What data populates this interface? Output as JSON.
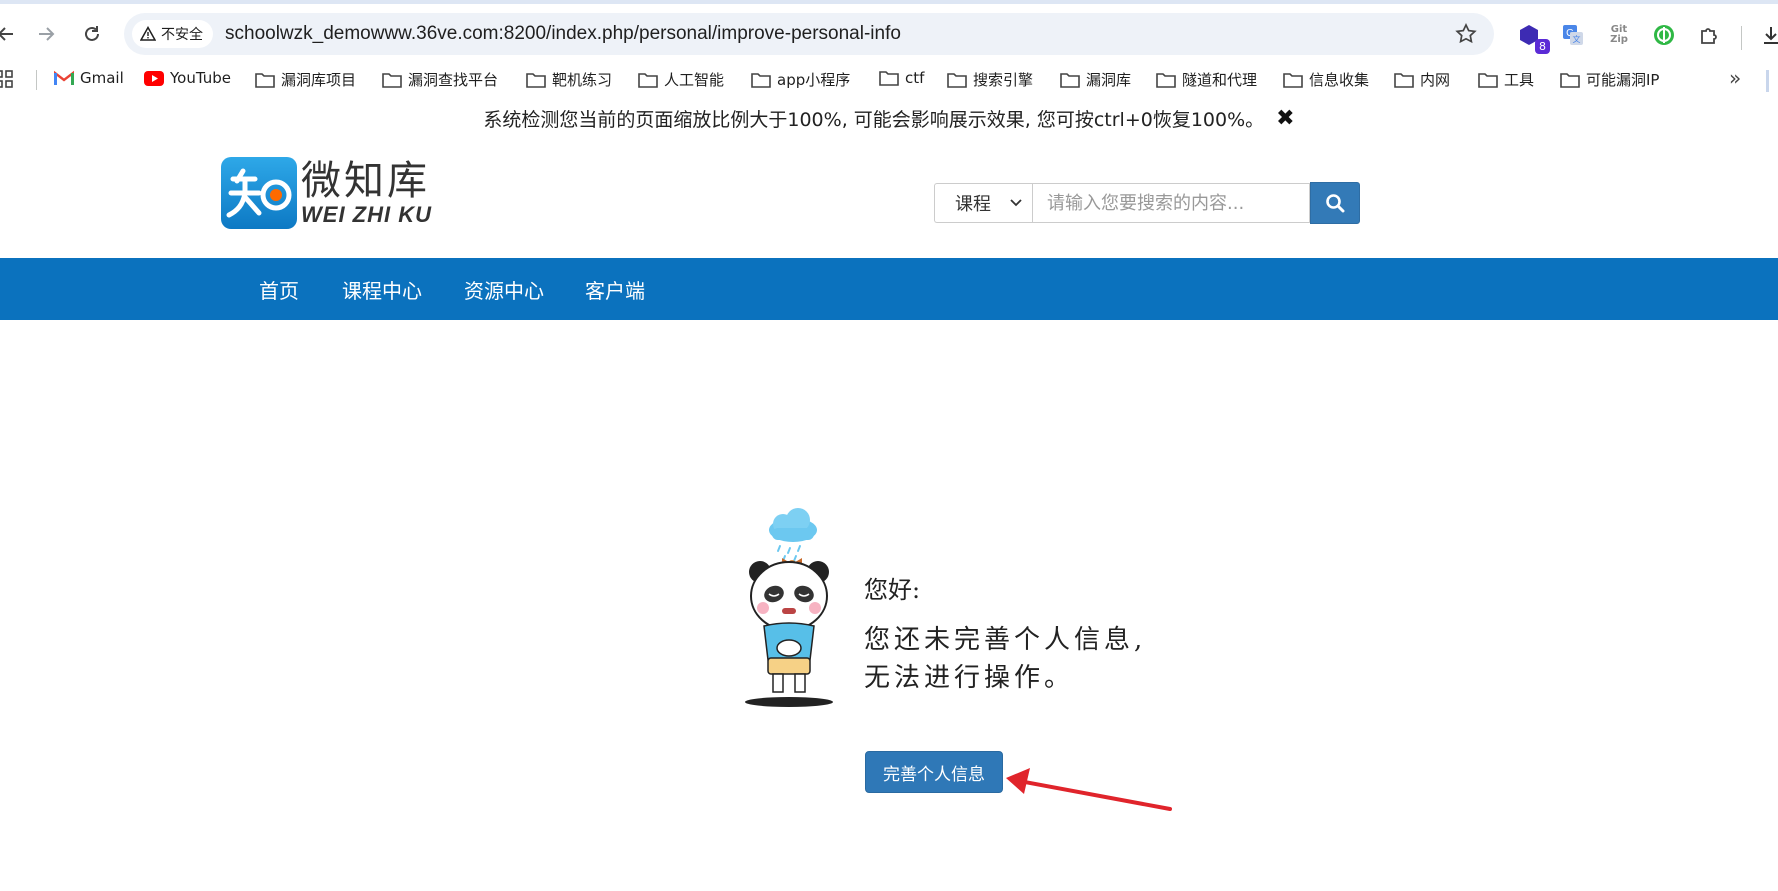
{
  "browser": {
    "security_label": "不安全",
    "url": "schoolwzk_demowww.36ve.com:8200/index.php/personal/improve-personal-info",
    "extension_badge": "8",
    "gitzip_line1": "Git",
    "gitzip_line2": "Zip"
  },
  "bookmarks": [
    {
      "label": "Gmail",
      "icon": "gmail-icon"
    },
    {
      "label": "YouTube",
      "icon": "youtube-icon"
    },
    {
      "label": "漏洞库项目",
      "icon": "folder-icon"
    },
    {
      "label": "漏洞查找平台",
      "icon": "folder-icon"
    },
    {
      "label": "靶机练习",
      "icon": "folder-icon"
    },
    {
      "label": "人工智能",
      "icon": "folder-icon"
    },
    {
      "label": "app小程序",
      "icon": "folder-icon"
    },
    {
      "label": "ctf",
      "icon": "folder-icon"
    },
    {
      "label": "搜索引擎",
      "icon": "folder-icon"
    },
    {
      "label": "漏洞库",
      "icon": "folder-icon"
    },
    {
      "label": "隧道和代理",
      "icon": "folder-icon"
    },
    {
      "label": "信息收集",
      "icon": "folder-icon"
    },
    {
      "label": "内网",
      "icon": "folder-icon"
    },
    {
      "label": "工具",
      "icon": "folder-icon"
    },
    {
      "label": "可能漏洞IP",
      "icon": "folder-icon"
    }
  ],
  "notice": {
    "text": "系统检测您当前的页面缩放比例大于100%, 可能会影响展示效果, 您可按ctrl+0恢复100%。",
    "close": "✖"
  },
  "logo": {
    "mark": "知",
    "cn": "微知库",
    "en": "WEI ZHI KU"
  },
  "search": {
    "category": "课程",
    "placeholder": "请输入您要搜索的内容..."
  },
  "nav": {
    "items": [
      "首页",
      "课程中心",
      "资源中心",
      "客户端"
    ]
  },
  "message": {
    "greeting": "您好:",
    "line1": "您还未完善个人信息,",
    "line2": "无法进行操作。"
  },
  "cta": {
    "label": "完善个人信息"
  },
  "colors": {
    "nav_bar": "#0b72be",
    "button": "#2f78b7",
    "annotation_arrow": "#e0242b"
  }
}
